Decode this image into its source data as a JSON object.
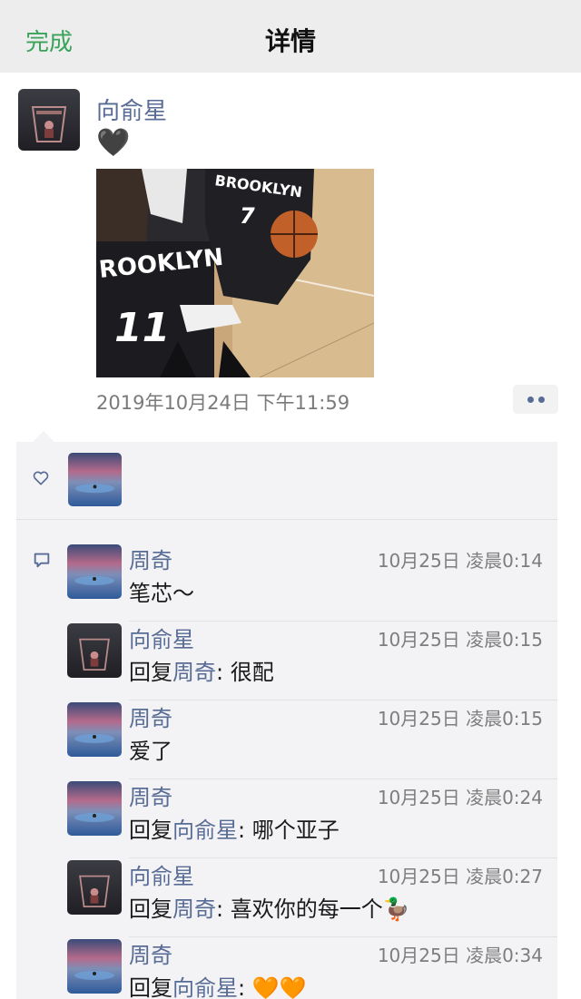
{
  "topbar": {
    "done_label": "完成",
    "title": "详情"
  },
  "post": {
    "author": "向俞星",
    "text": "🖤",
    "photo_numbers": [
      "7",
      "11"
    ],
    "photo_text": "ROOKLYN",
    "photo_text_back": "BROOKLYN",
    "time": "2019年10月24日 下午11:59"
  },
  "comments": [
    {
      "name": "周奇",
      "time": "10月25日 凌晨0:14",
      "reply_label": "",
      "reply_to": "",
      "text": "笔芯～"
    },
    {
      "name": "向俞星",
      "time": "10月25日 凌晨0:15",
      "reply_label": "回复",
      "reply_to": "周奇",
      "text": ": 很配"
    },
    {
      "name": "周奇",
      "time": "10月25日 凌晨0:15",
      "reply_label": "",
      "reply_to": "",
      "text": "爱了"
    },
    {
      "name": "周奇",
      "time": "10月25日 凌晨0:24",
      "reply_label": "回复",
      "reply_to": "向俞星",
      "text": ": 哪个亚子"
    },
    {
      "name": "向俞星",
      "time": "10月25日 凌晨0:27",
      "reply_label": "回复",
      "reply_to": "周奇",
      "text": ": 喜欢你的每一个🦆"
    },
    {
      "name": "周奇",
      "time": "10月25日 凌晨0:34",
      "reply_label": "回复",
      "reply_to": "向俞星",
      "text": ": 🧡🧡"
    }
  ],
  "colors": {
    "name_link": "#576b95",
    "done_green": "#3aa35a",
    "nav_bg": "#ededed",
    "panel_bg": "#f3f3f5"
  }
}
